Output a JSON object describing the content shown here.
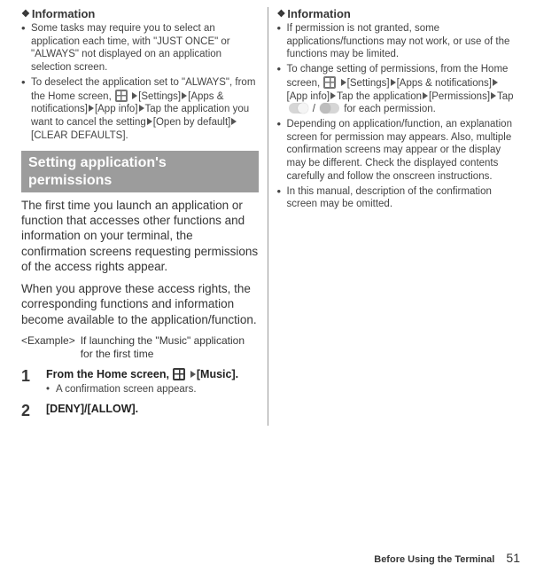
{
  "left": {
    "info_heading": "Information",
    "bullets": [
      "Some tasks may require you to select an application each time, with \"JUST ONCE\" or \"ALWAYS\" not displayed on an application selection screen.",
      "To deselect the application set to \"ALWAYS\", from the Home screen, __GRID__ __TRI__[Settings]__TRI__[Apps & notifications]__TRI__[App info]__TRI__Tap the application you want to cancel the setting__TRI__[Open by default]__TRI__[CLEAR DEFAULTS]."
    ],
    "section_heading": "Setting application's permissions",
    "body1": "The first time you launch an application or function that accesses other functions and information on your terminal, the confirmation screens requesting permissions of the access rights appear.",
    "body2": "When you approve these access rights, the corresponding functions and information become available to the application/function.",
    "example_label": "<Example>",
    "example_text": "If launching the \"Music\" application for the first time",
    "steps": [
      {
        "num": "1",
        "title": "From the Home screen, __GRIDD__ __TRI__[Music].",
        "note": "A confirmation screen appears."
      },
      {
        "num": "2",
        "title": "[DENY]/[ALLOW].",
        "note": ""
      }
    ]
  },
  "right": {
    "info_heading": "Information",
    "bullets": [
      "If permission is not granted, some applications/functions may not work, or use of the functions may be limited.",
      "To change setting of permissions, from the Home screen, __GRID__ __TRI__[Settings]__TRI__[Apps & notifications]__TRI__[App info]__TRI__Tap the application__TRI__[Permissions]__TRI__Tap __TOGGLE__ / __TOGGLEOFF__ for each permission.",
      "Depending on application/function, an explanation screen for permission may appears. Also, multiple confirmation screens may appear or the display may be different. Check the displayed contents carefully and follow the onscreen instructions.",
      "In this manual, description of the confirmation screen may be omitted."
    ]
  },
  "footer": {
    "section": "Before Using the Terminal",
    "page": "51"
  }
}
